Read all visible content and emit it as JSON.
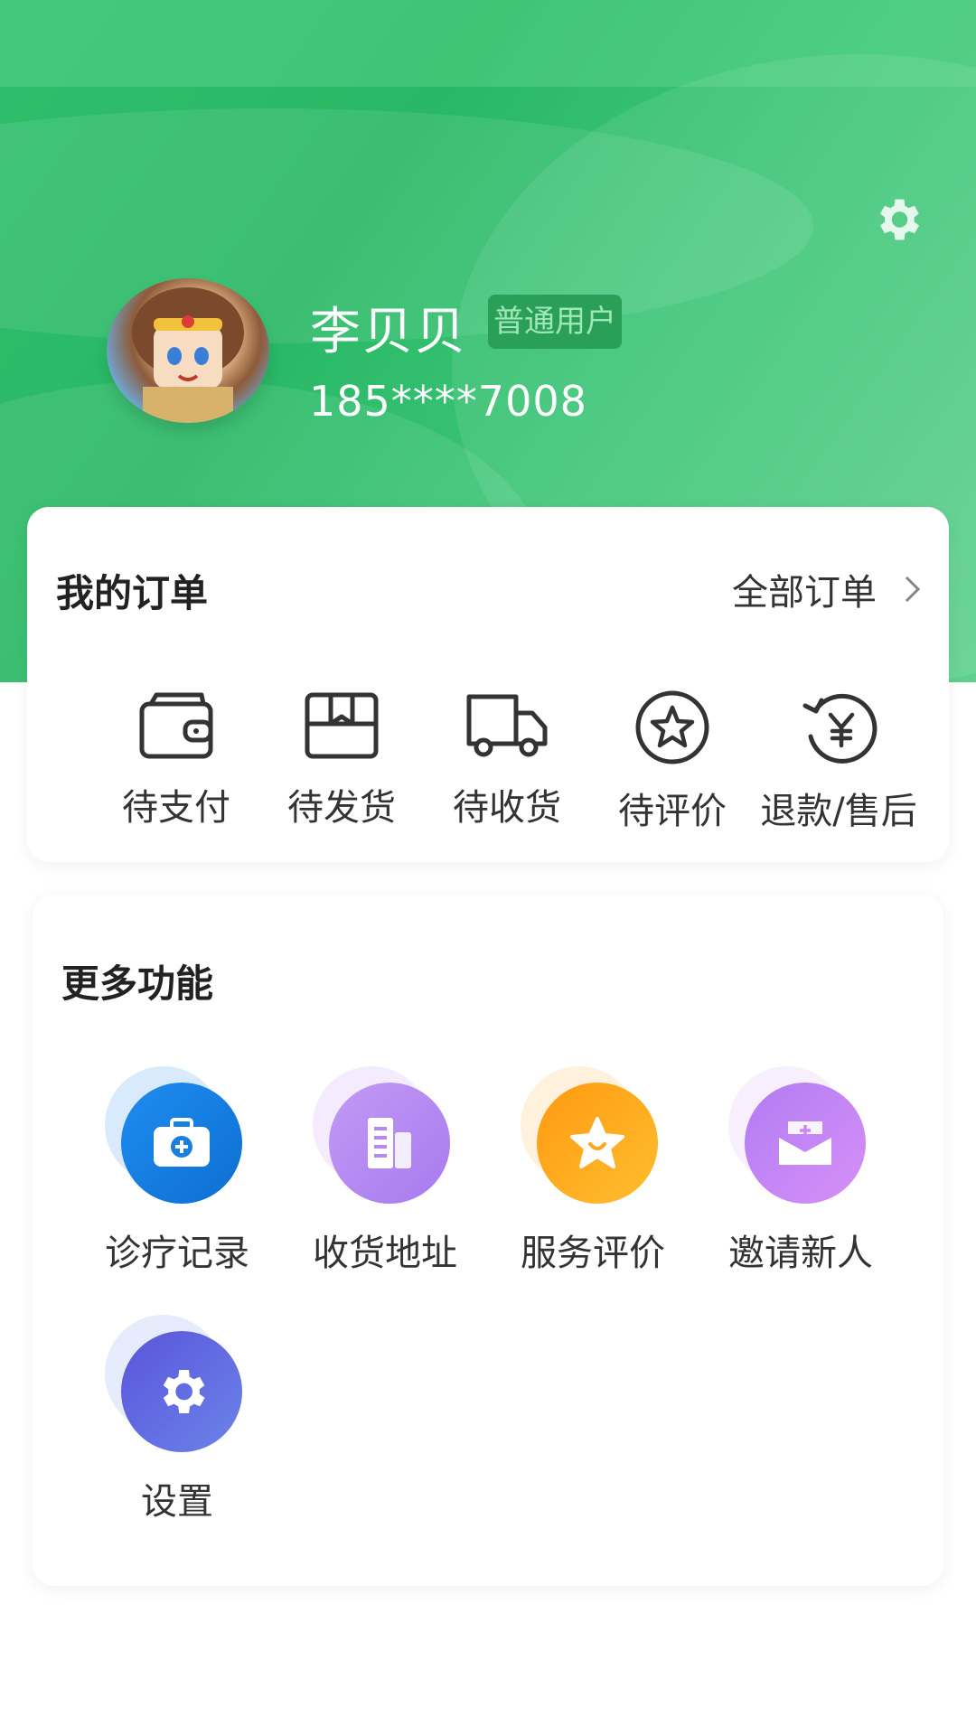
{
  "profile": {
    "name": "李贝贝",
    "badge": "普通用户",
    "phone": "185****7008"
  },
  "orders": {
    "title": "我的订单",
    "all_label": "全部订单",
    "items": [
      {
        "label": "待支付",
        "icon": "wallet-icon"
      },
      {
        "label": "待发货",
        "icon": "package-icon"
      },
      {
        "label": "待收货",
        "icon": "truck-icon"
      },
      {
        "label": "待评价",
        "icon": "star-circle-icon"
      },
      {
        "label": "退款/售后",
        "icon": "refund-yen-icon"
      }
    ]
  },
  "more": {
    "title": "更多功能",
    "items": [
      {
        "label": "诊疗记录",
        "icon": "medical-kit-icon",
        "color": "#1a7fe0"
      },
      {
        "label": "收货地址",
        "icon": "building-icon",
        "color": "#b58af2"
      },
      {
        "label": "服务评价",
        "icon": "smiley-star-icon",
        "color": "#ffa51a"
      },
      {
        "label": "邀请新人",
        "icon": "envelope-plus-icon",
        "color": "#c987f5"
      },
      {
        "label": "设置",
        "icon": "gear-icon",
        "color": "#5b63e0"
      }
    ]
  },
  "colors": {
    "header_green": "#2fbf6c",
    "badge_bg": "#2a9f58"
  }
}
